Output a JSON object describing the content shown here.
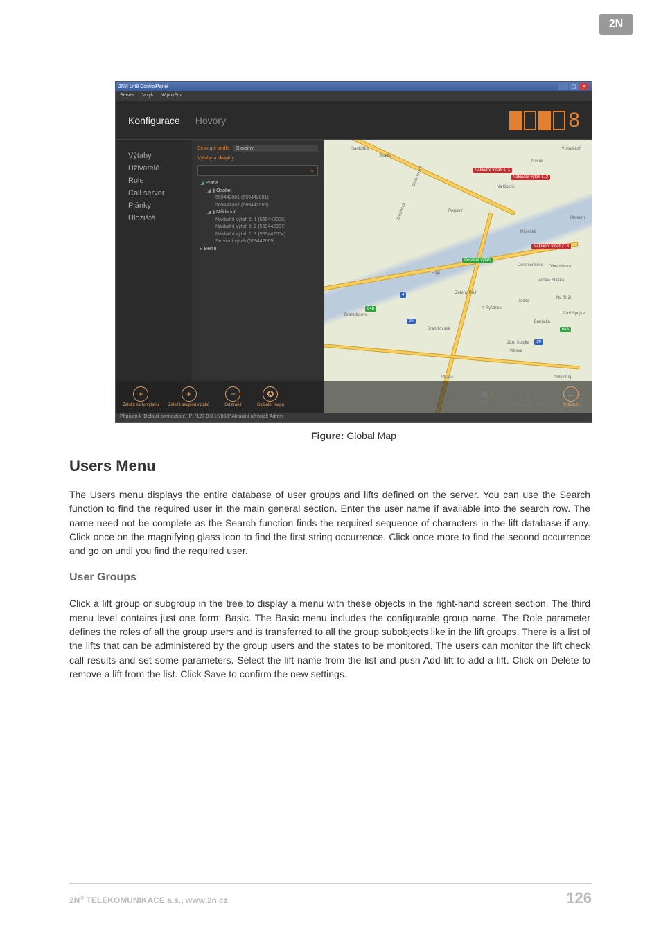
{
  "logo_top": "2N",
  "window": {
    "title": "2N® Lift8 ControlPanel",
    "menubar": [
      "Server",
      "Jazyk",
      "Nápověda"
    ],
    "tabs": {
      "config": "Konfigurace",
      "calls": "Hovory"
    },
    "lift_logo_text": "8",
    "sidebar": [
      "Výtahy",
      "Uživatelé",
      "Role",
      "Call server",
      "Plánky",
      "Uložiště"
    ],
    "tree": {
      "group_label": "Seskupit podle:",
      "group_value": "Skupiny",
      "section_title": "Výtahy a skupiny",
      "search_placeholder": "",
      "nodes": {
        "praha": "Praha",
        "osobni": "Osobní",
        "osobni_items": [
          "569442001 (569442001)",
          "569442002 (569442002)"
        ],
        "nakladni": "Nákladní",
        "nakladni_items": [
          "Nákladní výtah č. 1 (569442006)",
          "Nákladní výtah č. 2 (569442007)",
          "Nákladní výtah č. 3 (569442004)",
          "Servisní výtah (569442005)"
        ],
        "berlin": "Berlin"
      }
    },
    "map": {
      "labels": [
        "Santoška",
        "Skalka",
        "V stárkách",
        "Novák",
        "Strakonická",
        "Na Dolnici",
        "Procení",
        "Dvořecká",
        "Milevská",
        "Olbrachtova",
        "U Háje",
        "Jeremenkova",
        "Antala Staška",
        "Zelený Pruh",
        "Točná",
        "Na Strži",
        "K Ryšánce",
        "Jižní Spojka",
        "Branická",
        "Jižní Spojka",
        "Vrbova",
        "Vltava",
        "Velký háj",
        "Ohradní",
        "Branišovská",
        "Brandějsova"
      ],
      "pins": [
        "Nákladní výtah č. 1",
        "Nákladní výtah č. 2",
        "Nákladní výtah č. 3",
        "Servisní výtah",
        "648",
        "4",
        "20",
        "20",
        "648"
      ]
    },
    "toolbar": {
      "add_card": "Založit kartu výtahu",
      "add_group": "Založit skupinu výtahů",
      "remove": "Odstranit",
      "global_map": "Globální mapa",
      "save": "Uložit",
      "revert": "Vrátit všechny změny",
      "logout": "Odhlásit"
    },
    "statusbar": "Připojen k 'Default connection'. IP: \"127.0.0.1:7008\"  Aktuální uživatel: Admin"
  },
  "figure_caption_label": "Figure:",
  "figure_caption_text": " Global Map",
  "doc": {
    "h2": "Users Menu",
    "p1": "The Users menu displays the entire database of user groups and lifts defined on the server. You can use the Search function to find the required user in the main general section. Enter the user name if available into the search row. The name need not be complete as the Search function finds the required sequence of characters in the lift database if any. Click once on the magnifying glass icon to find the first string occurrence. Click once more to find the second occurrence and go on until you find the required user.",
    "h3": "User Groups",
    "p2": "Click a lift group or subgroup in the tree to display a menu with these objects in the right-hand screen section. The third menu level contains just one form: Basic. The Basic menu includes the configurable group name. The Role parameter defines the roles of all the group users and is transferred to all the group subobjects like in the lift groups. There is a list of the lifts that can be administered by the group users and the states to be monitored. The users can monitor the lift check call results and set some parameters. Select the lift name from the list and push Add lift to add a lift. Click on Delete to remove a lift from the list. Click Save to confirm the new settings."
  },
  "footer": {
    "left_prefix": "2N",
    "left_sup": "®",
    "left_rest": " TELEKOMUNIKACE a.s., www.2n.cz",
    "page": "126"
  }
}
